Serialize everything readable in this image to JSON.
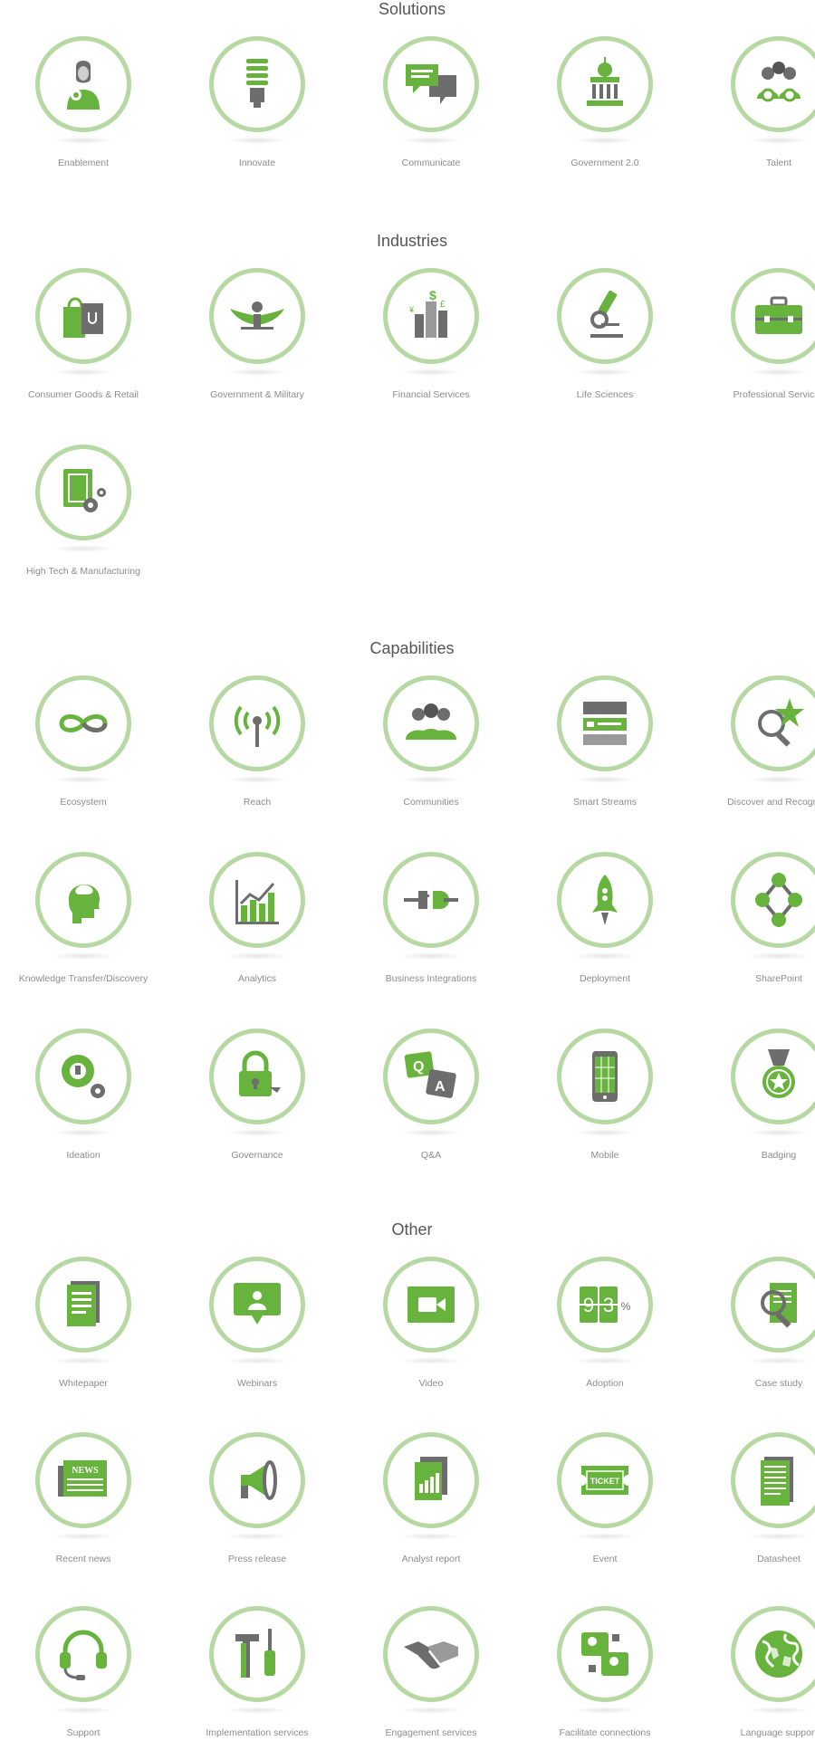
{
  "colors": {
    "green": "#67b33d",
    "dark_green": "#4f9a2b",
    "gray": "#6d6d6d",
    "ring": "#b6d8a2"
  },
  "sections": [
    {
      "title": "Solutions",
      "items": [
        {
          "label": "Enablement",
          "icon": "person-badge-icon"
        },
        {
          "label": "Innovate",
          "icon": "lightbulb-icon"
        },
        {
          "label": "Communicate",
          "icon": "chat-bubbles-icon"
        },
        {
          "label": "Government 2.0",
          "icon": "capitol-icon"
        },
        {
          "label": "Talent",
          "icon": "team-awards-icon"
        }
      ]
    },
    {
      "title": "Industries",
      "items": [
        {
          "label": "Consumer Goods & Retail",
          "icon": "shopping-bags-icon"
        },
        {
          "label": "Government & Military",
          "icon": "eagle-icon"
        },
        {
          "label": "Financial Services",
          "icon": "currency-buildings-icon"
        },
        {
          "label": "Life Sciences",
          "icon": "microscope-icon"
        },
        {
          "label": "Professional Services",
          "icon": "briefcase-icon"
        },
        {
          "label": "High Tech & Manufacturing",
          "icon": "chip-gears-icon"
        }
      ]
    },
    {
      "title": "Capabilities",
      "items": [
        {
          "label": "Ecosystem",
          "icon": "infinity-icon"
        },
        {
          "label": "Reach",
          "icon": "antenna-icon"
        },
        {
          "label": "Communities",
          "icon": "people-group-icon"
        },
        {
          "label": "Smart Streams",
          "icon": "stream-cards-icon"
        },
        {
          "label": "Discover and Recognize",
          "icon": "magnifier-star-icon"
        },
        {
          "label": "Knowledge Transfer/Discovery",
          "icon": "head-brain-icon"
        },
        {
          "label": "Analytics",
          "icon": "bar-chart-icon"
        },
        {
          "label": "Business Integrations",
          "icon": "plug-icon"
        },
        {
          "label": "Deployment",
          "icon": "rocket-icon"
        },
        {
          "label": "SharePoint",
          "icon": "network-nodes-icon"
        },
        {
          "label": "Ideation",
          "icon": "gear-bulb-icon"
        },
        {
          "label": "Governance",
          "icon": "padlock-icon"
        },
        {
          "label": "Q&A",
          "icon": "qa-bubbles-icon"
        },
        {
          "label": "Mobile",
          "icon": "smartphone-icon"
        },
        {
          "label": "Badging",
          "icon": "medal-icon"
        }
      ]
    },
    {
      "title": "Other",
      "items": [
        {
          "label": "Whitepaper",
          "icon": "document-icon"
        },
        {
          "label": "Webinars",
          "icon": "presenter-icon"
        },
        {
          "label": "Video",
          "icon": "video-camera-icon"
        },
        {
          "label": "Adoption",
          "icon": "percent-counter-icon",
          "text": [
            "9",
            "3",
            "%"
          ]
        },
        {
          "label": "Case study",
          "icon": "document-magnifier-icon"
        },
        {
          "label": "Recent news",
          "icon": "newspaper-icon",
          "text": [
            "NEWS"
          ]
        },
        {
          "label": "Press release",
          "icon": "megaphone-icon"
        },
        {
          "label": "Analyst report",
          "icon": "report-chart-icon"
        },
        {
          "label": "Event",
          "icon": "ticket-icon",
          "text": [
            "TICKET"
          ]
        },
        {
          "label": "Datasheet",
          "icon": "datasheet-icon"
        },
        {
          "label": "Support",
          "icon": "headset-icon"
        },
        {
          "label": "Implementation services",
          "icon": "tools-icon"
        },
        {
          "label": "Engagement services",
          "icon": "handshake-icon"
        },
        {
          "label": "Facilitate connections",
          "icon": "connections-icon"
        },
        {
          "label": "Language support",
          "icon": "globe-icon"
        }
      ]
    }
  ]
}
